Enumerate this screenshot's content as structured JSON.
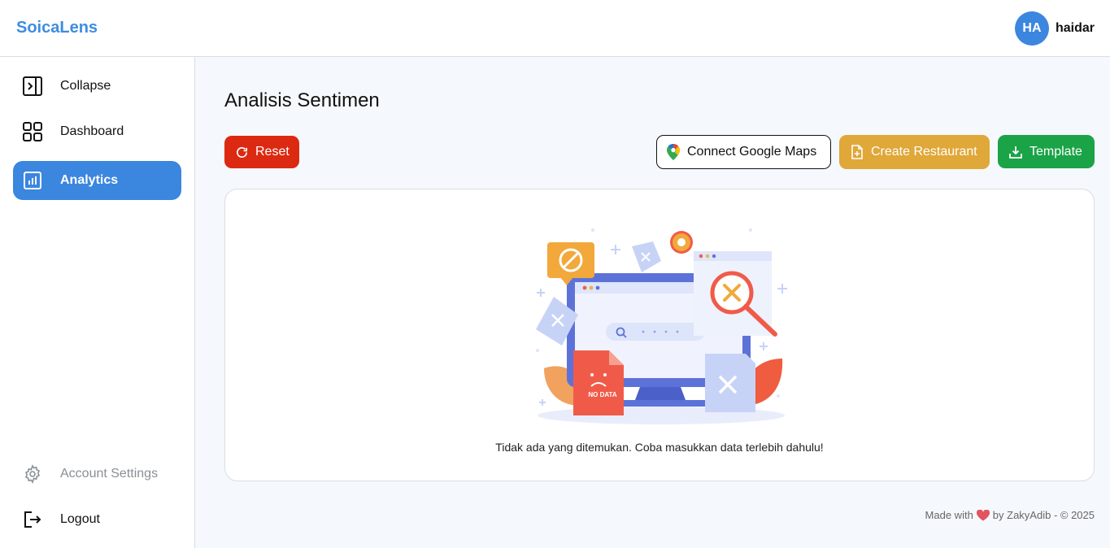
{
  "app": {
    "brand": "SoicaLens"
  },
  "user": {
    "initials": "HA",
    "name": "haidar"
  },
  "sidebar": {
    "items": [
      {
        "label": "Collapse",
        "icon": "sidebar-collapse-icon"
      },
      {
        "label": "Dashboard",
        "icon": "grid-icon"
      },
      {
        "label": "Analytics",
        "icon": "bar-chart-icon",
        "active": true
      }
    ],
    "bottom": [
      {
        "label": "Account Settings",
        "icon": "gear-icon"
      },
      {
        "label": "Logout",
        "icon": "logout-icon"
      }
    ]
  },
  "main": {
    "title": "Analisis Sentimen",
    "buttons": {
      "reset": "Reset",
      "connect_maps": "Connect Google Maps",
      "create_restaurant": "Create Restaurant",
      "template": "Template"
    },
    "empty_state": {
      "illustration_label": "NO DATA",
      "message": "Tidak ada yang ditemukan. Coba masukkan data terlebih dahulu!"
    }
  },
  "footer": {
    "made_with": "Made with",
    "by": "by ZakyAdib - © 2025"
  },
  "colors": {
    "primary": "#3b86df",
    "reset": "#dc2911",
    "create": "#e0a739",
    "template": "#1aa347"
  }
}
